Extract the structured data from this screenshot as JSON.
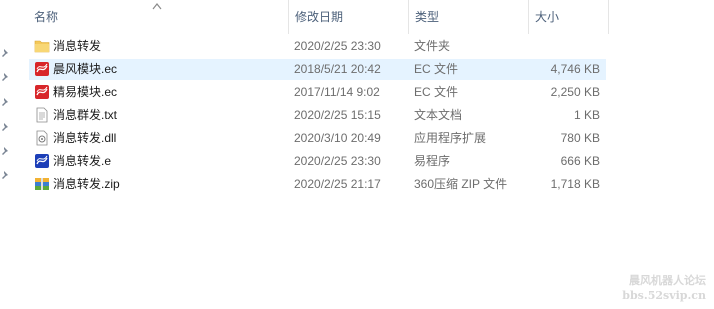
{
  "columns": {
    "name": "名称",
    "date": "修改日期",
    "type": "类型",
    "size": "大小"
  },
  "files": [
    {
      "name": "消息转发",
      "date": "2020/2/25 23:30",
      "type": "文件夹",
      "size": "",
      "icon": "folder-icon"
    },
    {
      "name": "晨风模块.ec",
      "date": "2018/5/21 20:42",
      "type": "EC 文件",
      "size": "4,746 KB",
      "icon": "ec-file-icon",
      "selected": true
    },
    {
      "name": "精易模块.ec",
      "date": "2017/11/14 9:02",
      "type": "EC 文件",
      "size": "2,250 KB",
      "icon": "ec-file-icon"
    },
    {
      "name": "消息群发.txt",
      "date": "2020/2/25 15:15",
      "type": "文本文档",
      "size": "1 KB",
      "icon": "text-file-icon"
    },
    {
      "name": "消息转发.dll",
      "date": "2020/3/10 20:49",
      "type": "应用程序扩展",
      "size": "780 KB",
      "icon": "dll-file-icon"
    },
    {
      "name": "消息转发.e",
      "date": "2020/2/25 23:30",
      "type": "易程序",
      "size": "666 KB",
      "icon": "e-file-icon"
    },
    {
      "name": "消息转发.zip",
      "date": "2020/2/25 21:17",
      "type": "360压缩 ZIP 文件",
      "size": "1,718 KB",
      "icon": "zip-file-icon"
    }
  ],
  "watermark": {
    "line1": "晨风机器人论坛",
    "line2": "bbs.52svip.cn"
  },
  "colors": {
    "selected_row": "#e5f3ff",
    "header_text": "#4c607a",
    "folder": "#f4c85a"
  }
}
